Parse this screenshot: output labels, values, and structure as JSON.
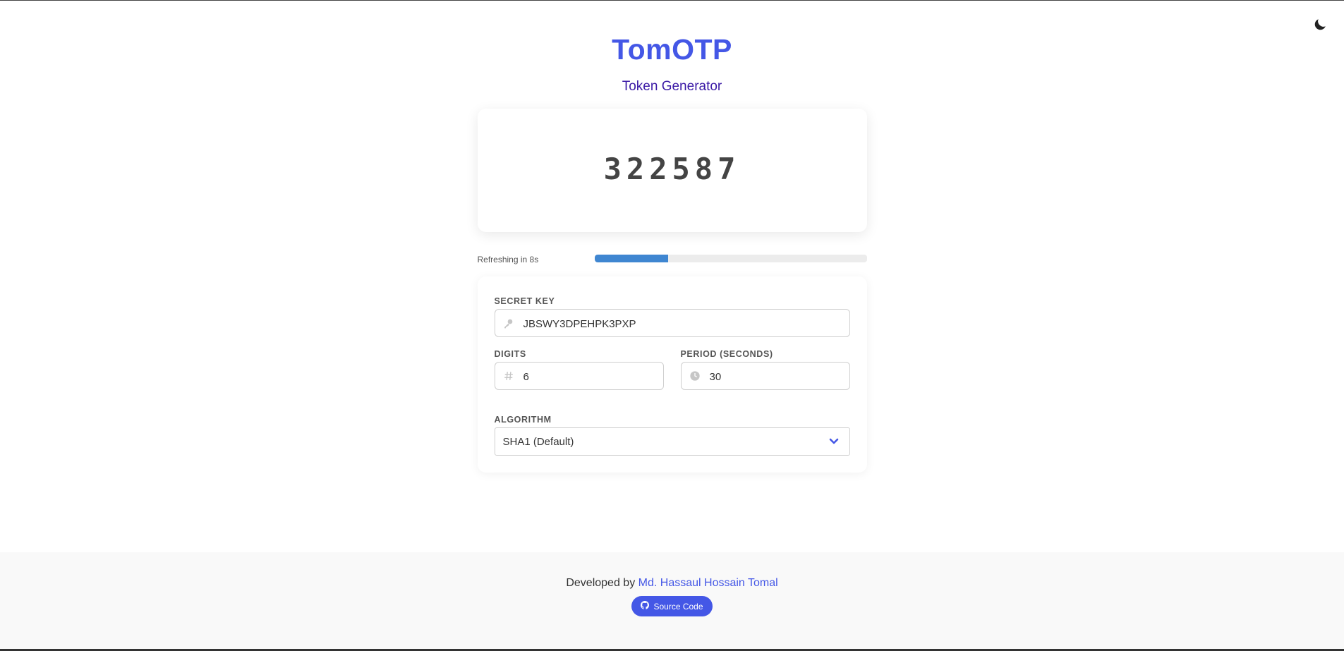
{
  "app": {
    "title": "TomOTP",
    "subtitle": "Token Generator"
  },
  "token": {
    "value": "322587"
  },
  "refresh": {
    "text": "Refreshing in 8s",
    "progress_fraction": 0.27,
    "bar_color": "#3f86d1"
  },
  "form": {
    "secret": {
      "label": "SECRET KEY",
      "value": "JBSWY3DPEHPK3PXP",
      "icon": "key-icon"
    },
    "digits": {
      "label": "DIGITS",
      "value": "6",
      "icon": "hash-icon"
    },
    "period": {
      "label": "PERIOD (SECONDS)",
      "value": "30",
      "icon": "clock-icon"
    },
    "algorithm": {
      "label": "ALGORITHM",
      "selected": "SHA1 (Default)",
      "icon": "chevron-down-icon"
    }
  },
  "footer": {
    "developed_by": "Developed by",
    "author": "Md. Hassaul Hossain Tomal",
    "source_label": "Source Code",
    "source_icon": "github-icon"
  },
  "theme": {
    "icon": "moon-icon"
  },
  "colors": {
    "accent": "#4457e6",
    "subtitle": "#3b1aa6"
  }
}
